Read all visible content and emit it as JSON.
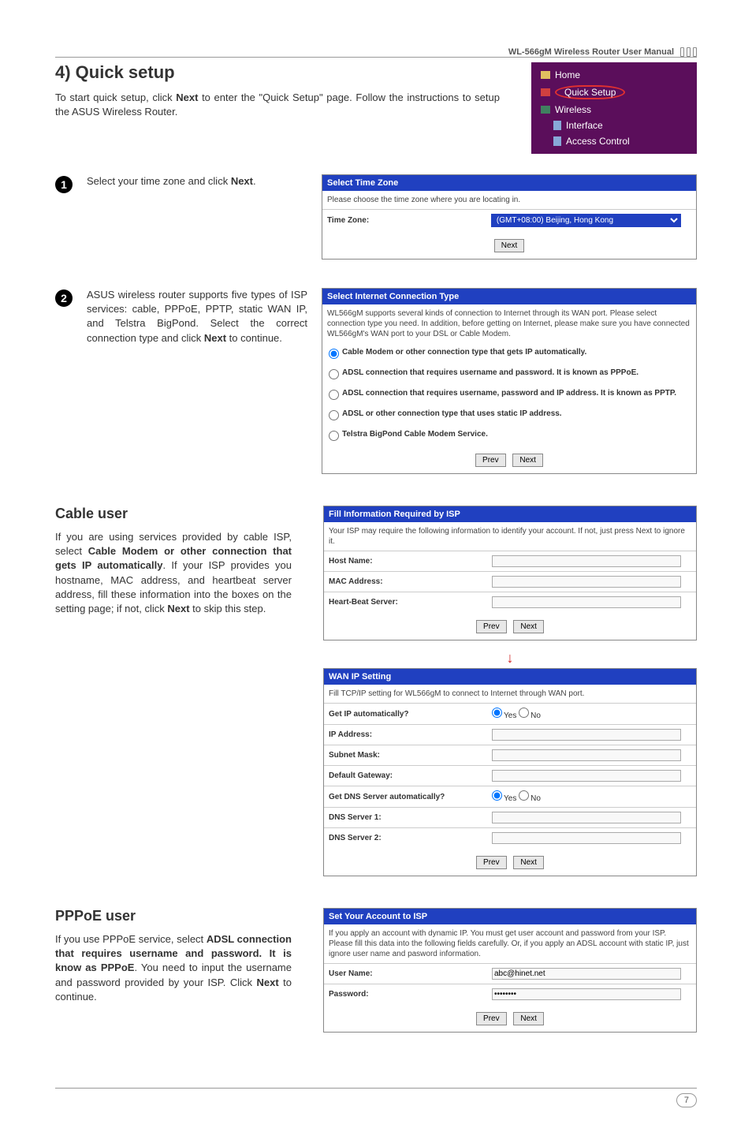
{
  "header": {
    "manual_title": "WL-566gM Wireless Router User Manual"
  },
  "section": {
    "title": "4) Quick setup",
    "intro_pre": "To start quick setup, click ",
    "intro_bold1": "Next",
    "intro_mid": " to enter the \"Quick Setup\" page. Follow the instructions to setup the ASUS Wireless Router."
  },
  "nav": {
    "home": "Home",
    "quick_setup": "Quick Setup",
    "wireless": "Wireless",
    "interface": "Interface",
    "access_control": "Access Control"
  },
  "step1": {
    "num": "1",
    "text_pre": "Select your time zone and click ",
    "text_bold": "Next",
    "text_post": "."
  },
  "tz_panel": {
    "title": "Select Time Zone",
    "desc": "Please choose the time zone where you are locating in.",
    "label": "Time Zone:",
    "value": "(GMT+08:00) Beijing, Hong Kong",
    "next": "Next"
  },
  "step2": {
    "num": "2",
    "text_pre": "ASUS wireless router  supports five types of ISP services: cable, PPPoE, PPTP, static WAN IP, and Telstra BigPond. Select the correct connection type and click ",
    "text_bold": "Next",
    "text_post": " to continue."
  },
  "conn_panel": {
    "title": "Select Internet Connection Type",
    "desc": "WL566gM supports several kinds of connection to Internet through its WAN port. Please select connection type you need. In addition, before getting on Internet, please make sure you have connected WL566gM's WAN port to your DSL or Cable Modem.",
    "opt1": "Cable Modem or other connection type that gets IP automatically.",
    "opt2": "ADSL connection that requires username and password. It is known as PPPoE.",
    "opt3": "ADSL connection that requires username, password and IP address. It is known as PPTP.",
    "opt4": "ADSL or other connection type that uses static IP address.",
    "opt5": "Telstra BigPond Cable Modem Service.",
    "prev": "Prev",
    "next": "Next"
  },
  "cable": {
    "title": "Cable user",
    "text_pre": "If you are using services provided by cable ISP, select ",
    "text_bold1": "Cable Modem or other connection that gets IP automatically",
    "text_mid": ". If your ISP provides you hostname, MAC address, and heartbeat server address, fill these information into the boxes on the setting page; if not, click ",
    "text_bold2": "Next",
    "text_post": " to skip this step."
  },
  "isp_panel": {
    "title": "Fill Information Required by ISP",
    "desc": "Your ISP may require the following information to identify your account. If not, just press Next to ignore it.",
    "host": "Host Name:",
    "mac": "MAC Address:",
    "hb": "Heart-Beat Server:",
    "prev": "Prev",
    "next": "Next"
  },
  "wan_panel": {
    "title": "WAN IP Setting",
    "desc": "Fill TCP/IP setting for WL566gM to connect to Internet through WAN port.",
    "get_ip": "Get IP automatically?",
    "ip": "IP Address:",
    "mask": "Subnet Mask:",
    "gw": "Default Gateway:",
    "get_dns": "Get DNS Server automatically?",
    "dns1": "DNS Server 1:",
    "dns2": "DNS Server 2:",
    "yes": "Yes",
    "no": "No",
    "prev": "Prev",
    "next": "Next"
  },
  "pppoe": {
    "title": "PPPoE user",
    "text_pre": "If you use PPPoE service, select ",
    "text_bold1": "ADSL connection that requires username and password. It is know as PPPoE",
    "text_mid": ". You need to input the username and password provided by your ISP. Click ",
    "text_bold2": "Next",
    "text_post": " to continue."
  },
  "acct_panel": {
    "title": "Set Your Account to ISP",
    "desc": "If you apply an account with dynamic IP. You must get user account and password from your ISP. Please fill this data into the following fields carefully. Or, if you apply an ADSL account with static IP, just ignore user name and pasword information.",
    "user": "User Name:",
    "user_val": "abc@hinet.net",
    "pass": "Password:",
    "pass_val": "••••••••",
    "prev": "Prev",
    "next": "Next"
  },
  "footer": {
    "page": "7"
  }
}
